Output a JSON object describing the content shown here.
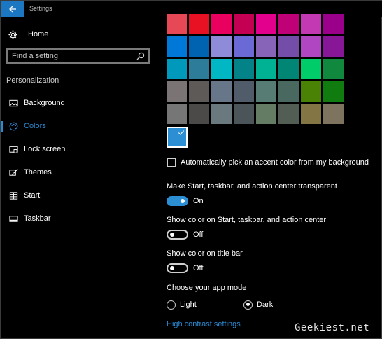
{
  "window": {
    "title": "Settings"
  },
  "sidebar": {
    "home_label": "Home",
    "search_placeholder": "Find a setting",
    "section_title": "Personalization",
    "items": [
      {
        "label": "Background",
        "icon": "image-icon",
        "active": false
      },
      {
        "label": "Colors",
        "icon": "palette-icon",
        "active": true
      },
      {
        "label": "Lock screen",
        "icon": "lock-screen-icon",
        "active": false
      },
      {
        "label": "Themes",
        "icon": "brush-icon",
        "active": false
      },
      {
        "label": "Start",
        "icon": "start-icon",
        "active": false
      },
      {
        "label": "Taskbar",
        "icon": "taskbar-icon",
        "active": false
      }
    ]
  },
  "colors": {
    "swatches": [
      [
        "#e74856",
        "#e81123",
        "#ea005e",
        "#c30052",
        "#e3008c",
        "#bf0077",
        "#c239b3",
        "#9a0089"
      ],
      [
        "#0078d7",
        "#0063b1",
        "#8e8cd8",
        "#6b69d6",
        "#8764b8",
        "#744da9",
        "#b146c2",
        "#881798"
      ],
      [
        "#0099bc",
        "#2d7d9a",
        "#00b7c3",
        "#038387",
        "#00b294",
        "#018574",
        "#00cc6a",
        "#10893e"
      ],
      [
        "#7a7574",
        "#5d5a58",
        "#68768a",
        "#515c6b",
        "#567c73",
        "#486860",
        "#498205",
        "#107c10"
      ],
      [
        "#767676",
        "#4c4a48",
        "#69797e",
        "#4a5459",
        "#647c64",
        "#525e54",
        "#847545",
        "#7e735f"
      ]
    ],
    "custom_color": "#2c8ed3",
    "accent": "#2a8ad4"
  },
  "settings": {
    "auto_accent_label": "Automatically pick an accent color from my background",
    "auto_accent_checked": false,
    "transparent_label": "Make Start, taskbar, and action center transparent",
    "transparent_state": "On",
    "start_color_label": "Show color on Start, taskbar, and action center",
    "start_color_state": "Off",
    "titlebar_color_label": "Show color on title bar",
    "titlebar_color_state": "Off",
    "app_mode_label": "Choose your app mode",
    "app_mode_options": [
      "Light",
      "Dark"
    ],
    "app_mode_selected": "Dark",
    "high_contrast_link": "High contrast settings"
  },
  "watermark": "Geekiest.net"
}
